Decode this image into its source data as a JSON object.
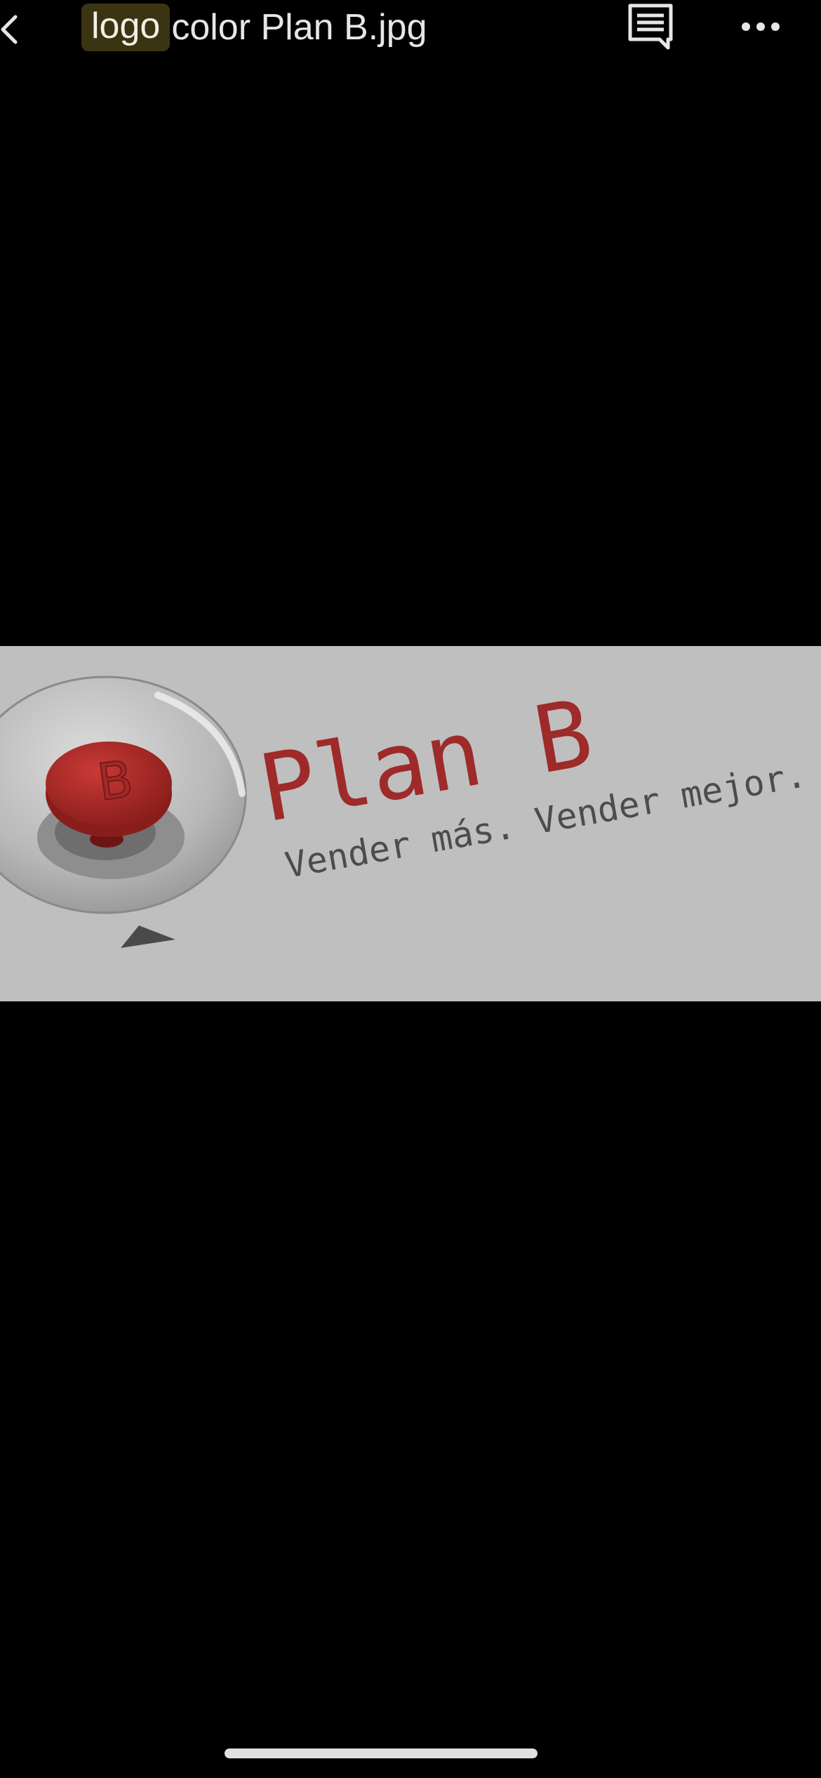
{
  "header": {
    "title_highlight": "logo",
    "title_rest": " color Plan B.jpg"
  },
  "image": {
    "logo_title": "Plan B",
    "logo_tagline": "Vender más. Vender mejor."
  },
  "icons": {
    "back": "chevron-left-icon",
    "comments": "comment-icon",
    "more": "more-horizontal-icon"
  },
  "colors": {
    "background": "#000000",
    "highlight": "#3b3413",
    "image_background": "#bfbfbf",
    "brand_red": "#9e2a2a"
  }
}
